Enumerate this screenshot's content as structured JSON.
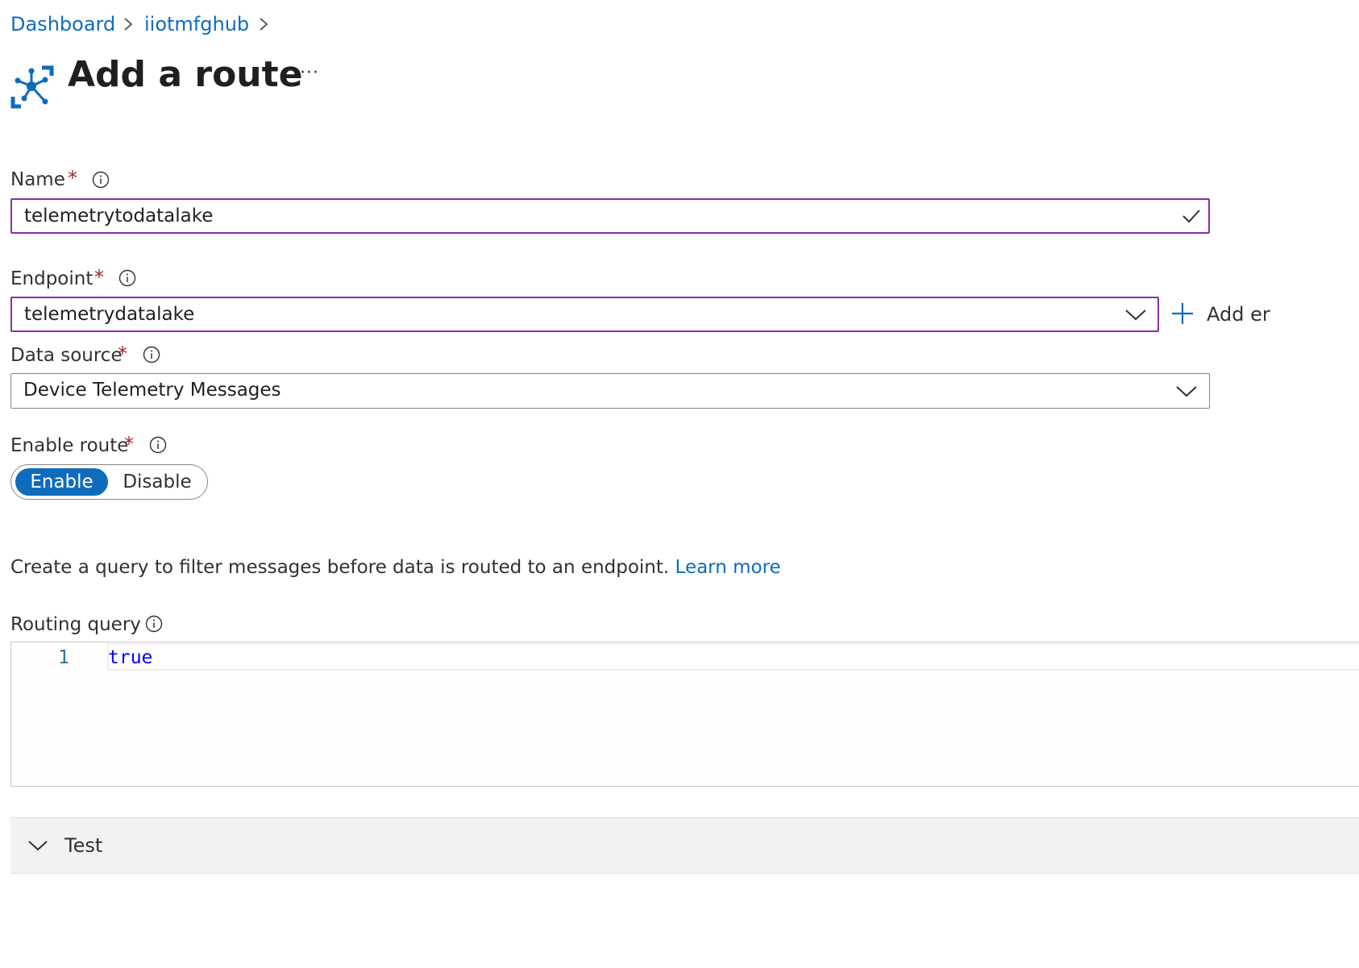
{
  "breadcrumb": {
    "items": [
      "Dashboard",
      "iiotmfghub"
    ]
  },
  "page": {
    "title": "Add a route",
    "more_label": "···",
    "icon": "iot-hub-route-icon"
  },
  "form": {
    "name": {
      "label": "Name",
      "required_mark": "*",
      "value": "telemetrytodatalake"
    },
    "endpoint": {
      "label": "Endpoint",
      "required_mark": "*",
      "value": "telemetrydatalake",
      "add_label": "Add er"
    },
    "data_source": {
      "label": "Data source",
      "required_mark": "*",
      "value": "Device Telemetry Messages"
    },
    "enable_route": {
      "label": "Enable route",
      "required_mark": "*",
      "options": [
        "Enable",
        "Disable"
      ],
      "selected": "Enable"
    },
    "description": {
      "text": "Create a query to filter messages before data is routed to an endpoint. ",
      "link": "Learn more"
    },
    "routing_query": {
      "label": "Routing query",
      "line_number": "1",
      "code": "true"
    }
  },
  "test_section": {
    "label": "Test"
  },
  "colors": {
    "accent": "#0f6cbd",
    "focus_border": "#8a2da5",
    "required": "#a4262c",
    "code_keyword": "#0000ff"
  }
}
